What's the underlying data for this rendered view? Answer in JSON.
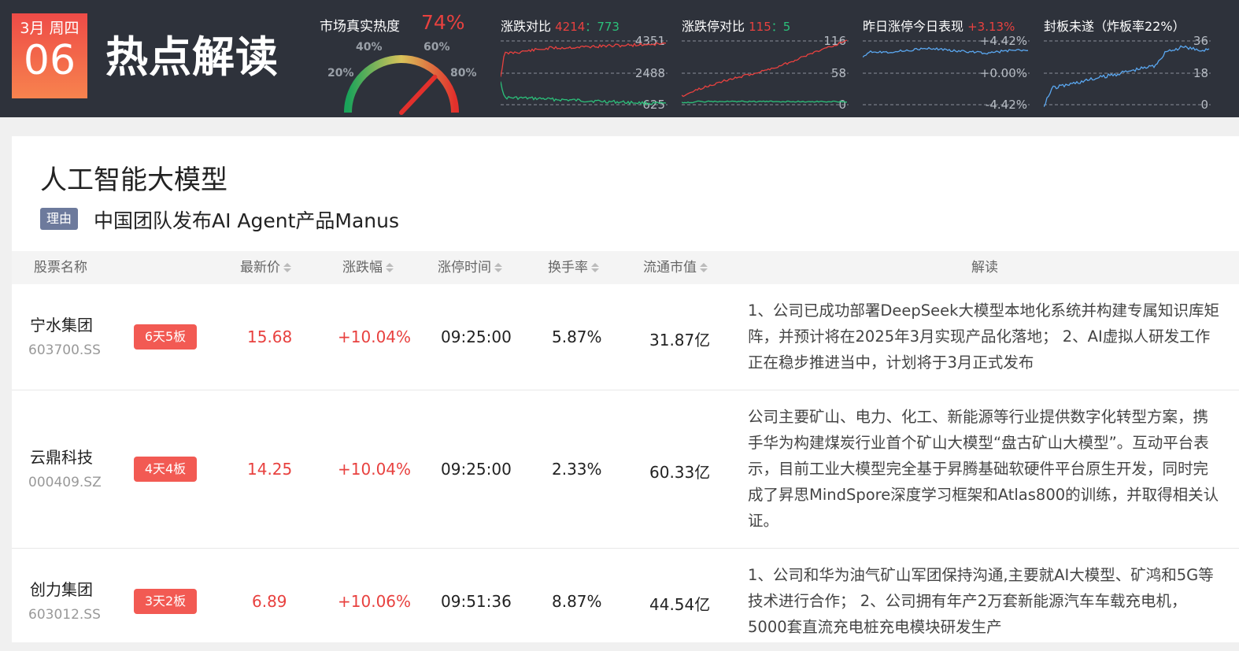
{
  "date": {
    "weekday": "3月 周四",
    "day": "06"
  },
  "page_title": "热点解读",
  "heat": {
    "title": "市场真实热度",
    "value": "74%",
    "value_number": 74,
    "ticks": [
      "20%",
      "40%",
      "60%",
      "80%"
    ]
  },
  "mini_charts": [
    {
      "title": "涨跌对比",
      "a": "4214",
      "sep": "：",
      "b": "773",
      "ylabels": [
        "4351",
        "2488",
        "625"
      ]
    },
    {
      "title": "涨跌停对比",
      "a": "115",
      "sep": "：",
      "b": "5",
      "ylabels": [
        "116",
        "58",
        "0"
      ]
    },
    {
      "title": "昨日涨停今日表现",
      "a": "+3.13%",
      "sep": "",
      "b": "",
      "ylabels": [
        "+4.42%",
        "+0.00%",
        "-4.42%"
      ]
    },
    {
      "title": "封板未遂（炸板率22%）",
      "a": "",
      "sep": "",
      "b": "",
      "ylabels": [
        "36",
        "18",
        "0"
      ]
    }
  ],
  "topic": {
    "title": "人工智能大模型",
    "reason_tag": "理由",
    "reason": "中国团队发布AI Agent产品Manus"
  },
  "table": {
    "headers": {
      "name": "股票名称",
      "price": "最新价",
      "change": "涨跌幅",
      "limit_time": "涨停时间",
      "turnover": "换手率",
      "market_cap": "流通市值",
      "analysis": "解读"
    },
    "rows": [
      {
        "name": "宁水集团",
        "code": "603700.SS",
        "streak": "6天5板",
        "price": "15.68",
        "change": "+10.04%",
        "limit_time": "09:25:00",
        "turnover": "5.87%",
        "market_cap": "31.87亿",
        "analysis": "1、公司已成功部署DeepSeek大模型本地化系统并构建专属知识库矩阵，并预计将在2025年3月实现产品化落地； 2、AI虚拟人研发工作正在稳步推进当中，计划将于3月正式发布"
      },
      {
        "name": "云鼎科技",
        "code": "000409.SZ",
        "streak": "4天4板",
        "price": "14.25",
        "change": "+10.04%",
        "limit_time": "09:25:00",
        "turnover": "2.33%",
        "market_cap": "60.33亿",
        "analysis": "公司主要矿山、电力、化工、新能源等行业提供数字化转型方案，携手华为构建煤炭行业首个矿山大模型“盘古矿山大模型”。互动平台表示，目前工业大模型完全基于昇腾基础软硬件平台原生开发，同时完成了昇思MindSpore深度学习框架和Atlas800的训练，并取得相关认证。"
      },
      {
        "name": "创力集团",
        "code": "603012.SS",
        "streak": "3天2板",
        "price": "6.89",
        "change": "+10.06%",
        "limit_time": "09:51:36",
        "turnover": "8.87%",
        "market_cap": "44.54亿",
        "analysis": "1、公司和华为油气矿山军团保持沟通,主要就AI大模型、矿鸿和5G等技术进行合作； 2、公司拥有年产2万套新能源汽车车载充电机，5000套直流充电桩充电模块研发生产"
      }
    ]
  },
  "colors": {
    "up": "#e8413f",
    "down": "#2bc07a",
    "blue": "#5aa7f0",
    "header_bg": "#2e323b"
  }
}
